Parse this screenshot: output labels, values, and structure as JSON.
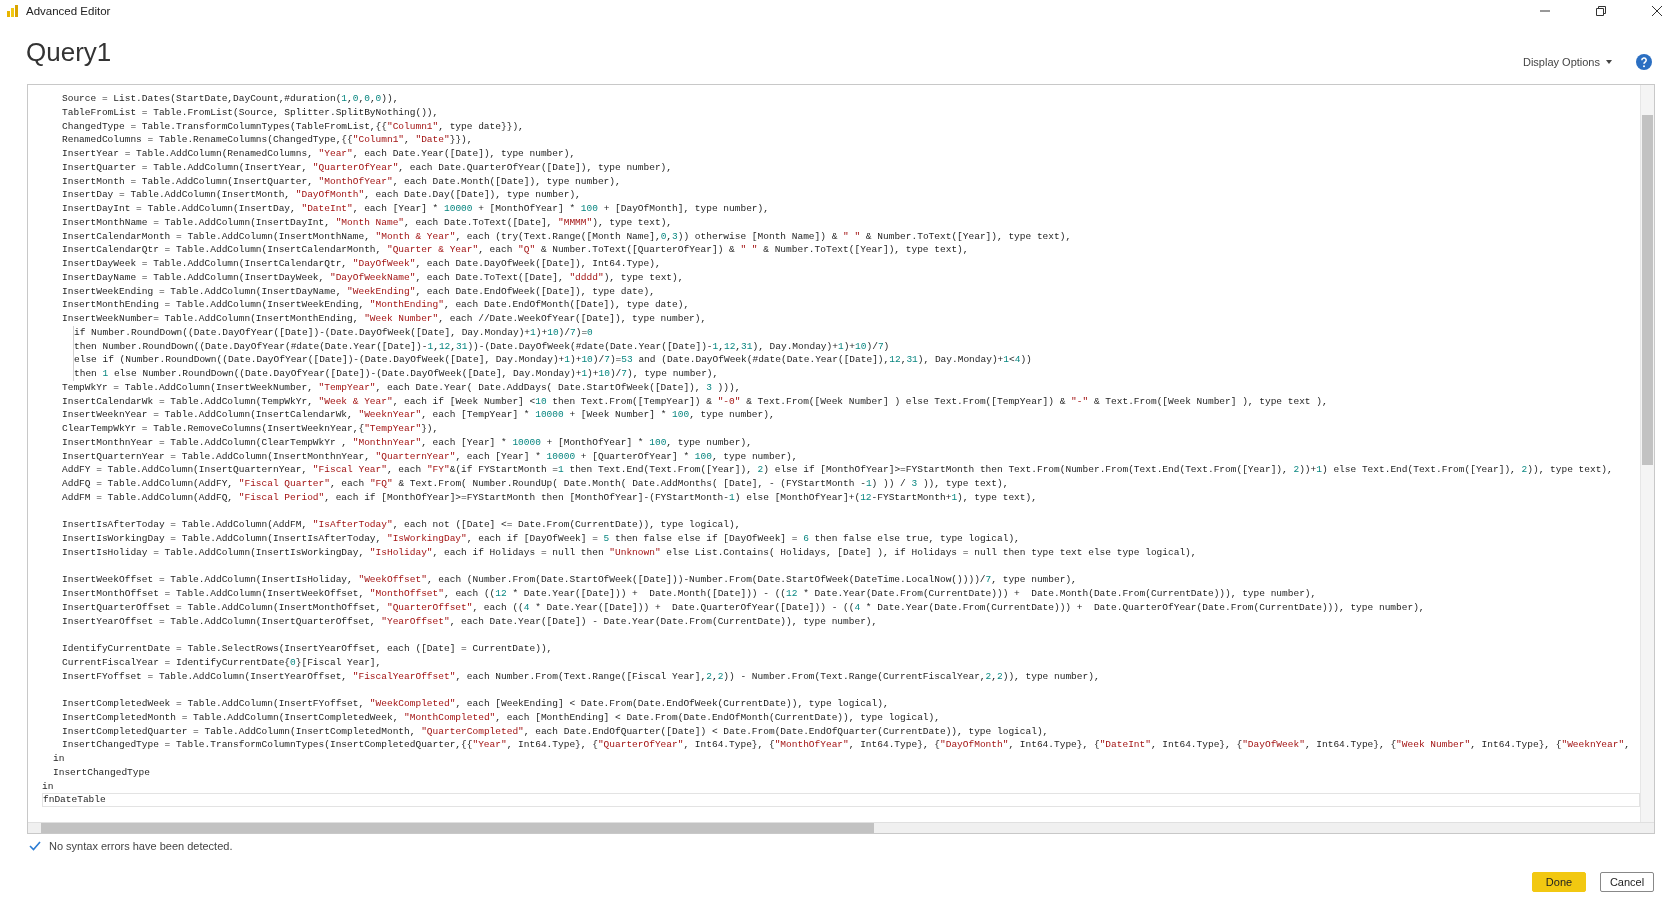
{
  "window": {
    "title": "Advanced Editor"
  },
  "query": {
    "title": "Query1"
  },
  "display_options": {
    "label": "Display Options"
  },
  "editor": {
    "lines": [
      {
        "kind": "statement",
        "current": false,
        "text": "Source = List.Dates(StartDate,DayCount,#duration(1,0,0,0)),"
      },
      {
        "kind": "statement",
        "current": false,
        "text": "TableFromList = Table.FromList(Source, Splitter.SplitByNothing()),"
      },
      {
        "kind": "statement",
        "current": false,
        "text": "ChangedType = Table.TransformColumnTypes(TableFromList,{{\"Column1\", type date}}),"
      },
      {
        "kind": "statement",
        "current": false,
        "text": "RenamedColumns = Table.RenameColumns(ChangedType,{{\"Column1\", \"Date\"}}),"
      },
      {
        "kind": "statement",
        "current": false,
        "text": "InsertYear = Table.AddColumn(RenamedColumns, \"Year\", each Date.Year([Date]), type number),"
      },
      {
        "kind": "statement",
        "current": false,
        "text": "InsertQuarter = Table.AddColumn(InsertYear, \"QuarterOfYear\", each Date.QuarterOfYear([Date]), type number),"
      },
      {
        "kind": "statement",
        "current": false,
        "text": "InsertMonth = Table.AddColumn(InsertQuarter, \"MonthOfYear\", each Date.Month([Date]), type number),"
      },
      {
        "kind": "statement",
        "current": false,
        "text": "InsertDay = Table.AddColumn(InsertMonth, \"DayOfMonth\", each Date.Day([Date]), type number),"
      },
      {
        "kind": "statement",
        "current": false,
        "text": "InsertDayInt = Table.AddColumn(InsertDay, \"DateInt\", each [Year] * 10000 + [MonthOfYear] * 100 + [DayOfMonth], type number),"
      },
      {
        "kind": "statement",
        "current": false,
        "text": "InsertMonthName = Table.AddColumn(InsertDayInt, \"Month Name\", each Date.ToText([Date], \"MMMM\"), type text),"
      },
      {
        "kind": "statement",
        "current": false,
        "text": "InsertCalendarMonth = Table.AddColumn(InsertMonthName, \"Month & Year\", each (try(Text.Range([Month Name],0,3)) otherwise [Month Name]) & \" \" & Number.ToText([Year]), type text),"
      },
      {
        "kind": "statement",
        "current": false,
        "text": "InsertCalendarQtr = Table.AddColumn(InsertCalendarMonth, \"Quarter & Year\", each \"Q\" & Number.ToText([QuarterOfYear]) & \" \" & Number.ToText([Year]), type text),"
      },
      {
        "kind": "statement",
        "current": false,
        "text": "InsertDayWeek = Table.AddColumn(InsertCalendarQtr, \"DayOfWeek\", each Date.DayOfWeek([Date]), Int64.Type),"
      },
      {
        "kind": "statement",
        "current": false,
        "text": "InsertDayName = Table.AddColumn(InsertDayWeek, \"DayOfWeekName\", each Date.ToText([Date], \"dddd\"), type text),"
      },
      {
        "kind": "statement",
        "current": false,
        "text": "InsertWeekEnding = Table.AddColumn(InsertDayName, \"WeekEnding\", each Date.EndOfWeek([Date]), type date),"
      },
      {
        "kind": "statement",
        "current": false,
        "text": "InsertMonthEnding = Table.AddColumn(InsertWeekEnding, \"MonthEnding\", each Date.EndOfMonth([Date]), type date),"
      },
      {
        "kind": "statement",
        "current": false,
        "text": "InsertWeekNumber= Table.AddColumn(InsertMonthEnding, \"Week Number\", each //Date.WeekOfYear([Date]), type number),"
      },
      {
        "kind": "continuation",
        "current": false,
        "text": "if Number.RoundDown((Date.DayOfYear([Date])-(Date.DayOfWeek([Date], Day.Monday)+1)+10)/7)=0"
      },
      {
        "kind": "continuation",
        "current": false,
        "text": "then Number.RoundDown((Date.DayOfYear(#date(Date.Year([Date])-1,12,31))-(Date.DayOfWeek(#date(Date.Year([Date])-1,12,31), Day.Monday)+1)+10)/7)"
      },
      {
        "kind": "continuation",
        "current": false,
        "text": "else if (Number.RoundDown((Date.DayOfYear([Date])-(Date.DayOfWeek([Date], Day.Monday)+1)+10)/7)=53 and (Date.DayOfWeek(#date(Date.Year([Date]),12,31), Day.Monday)+1<4))"
      },
      {
        "kind": "continuation",
        "current": false,
        "text": "then 1 else Number.RoundDown((Date.DayOfYear([Date])-(Date.DayOfWeek([Date], Day.Monday)+1)+10)/7), type number),"
      },
      {
        "kind": "statement",
        "current": false,
        "text": "TempWkYr = Table.AddColumn(InsertWeekNumber, \"TempYear\", each Date.Year( Date.AddDays( Date.StartOfWeek([Date]), 3 ))),"
      },
      {
        "kind": "statement",
        "current": false,
        "text": "InsertCalendarWk = Table.AddColumn(TempWkYr, \"Week & Year\", each if [Week Number] <10 then Text.From([TempYear]) & \"-0\" & Text.From([Week Number] ) else Text.From([TempYear]) & \"-\" & Text.From([Week Number] ), type text ),"
      },
      {
        "kind": "statement",
        "current": false,
        "text": "InsertWeeknYear = Table.AddColumn(InsertCalendarWk, \"WeeknYear\", each [TempYear] * 10000 + [Week Number] * 100, type number),"
      },
      {
        "kind": "statement",
        "current": false,
        "text": "ClearTempWkYr = Table.RemoveColumns(InsertWeeknYear,{\"TempYear\"}),"
      },
      {
        "kind": "statement",
        "current": false,
        "text": "InsertMonthnYear = Table.AddColumn(ClearTempWkYr , \"MonthnYear\", each [Year] * 10000 + [MonthOfYear] * 100, type number),"
      },
      {
        "kind": "statement",
        "current": false,
        "text": "InsertQuarternYear = Table.AddColumn(InsertMonthnYear, \"QuarternYear\", each [Year] * 10000 + [QuarterOfYear] * 100, type number),"
      },
      {
        "kind": "statement",
        "current": false,
        "text": "AddFY = Table.AddColumn(InsertQuarternYear, \"Fiscal Year\", each \"FY\"&(if FYStartMonth =1 then Text.End(Text.From([Year]), 2) else if [MonthOfYear]>=FYStartMonth then Text.From(Number.From(Text.End(Text.From([Year]), 2))+1) else Text.End(Text.From([Year]), 2)), type text),"
      },
      {
        "kind": "statement",
        "current": false,
        "text": "AddFQ = Table.AddColumn(AddFY, \"Fiscal Quarter\", each \"FQ\" & Text.From( Number.RoundUp( Date.Month( Date.AddMonths( [Date], - (FYStartMonth -1) )) / 3 )), type text),"
      },
      {
        "kind": "statement",
        "current": false,
        "text": "AddFM = Table.AddColumn(AddFQ, \"Fiscal Period\", each if [MonthOfYear]>=FYStartMonth then [MonthOfYear]-(FYStartMonth-1) else [MonthOfYear]+(12-FYStartMonth+1), type text),"
      },
      {
        "kind": "blank"
      },
      {
        "kind": "statement",
        "current": false,
        "text": "InsertIsAfterToday = Table.AddColumn(AddFM, \"IsAfterToday\", each not ([Date] <= Date.From(CurrentDate)), type logical),"
      },
      {
        "kind": "statement",
        "current": false,
        "text": "InsertIsWorkingDay = Table.AddColumn(InsertIsAfterToday, \"IsWorkingDay\", each if [DayOfWeek] = 5 then false else if [DayOfWeek] = 6 then false else true, type logical),"
      },
      {
        "kind": "statement",
        "current": false,
        "text": "InsertIsHoliday = Table.AddColumn(InsertIsWorkingDay, \"IsHoliday\", each if Holidays = null then \"Unknown\" else List.Contains( Holidays, [Date] ), if Holidays = null then type text else type logical),"
      },
      {
        "kind": "blank"
      },
      {
        "kind": "statement",
        "current": false,
        "text": "InsertWeekOffset = Table.AddColumn(InsertIsHoliday, \"WeekOffset\", each (Number.From(Date.StartOfWeek([Date]))-Number.From(Date.StartOfWeek(DateTime.LocalNow())))/7, type number),"
      },
      {
        "kind": "statement",
        "current": false,
        "text": "InsertMonthOffset = Table.AddColumn(InsertWeekOffset, \"MonthOffset\", each ((12 * Date.Year([Date])) +  Date.Month([Date])) - ((12 * Date.Year(Date.From(CurrentDate))) +  Date.Month(Date.From(CurrentDate))), type number),"
      },
      {
        "kind": "statement",
        "current": false,
        "text": "InsertQuarterOffset = Table.AddColumn(InsertMonthOffset, \"QuarterOffset\", each ((4 * Date.Year([Date])) +  Date.QuarterOfYear([Date])) - ((4 * Date.Year(Date.From(CurrentDate))) +  Date.QuarterOfYear(Date.From(CurrentDate))), type number),"
      },
      {
        "kind": "statement",
        "current": false,
        "text": "InsertYearOffset = Table.AddColumn(InsertQuarterOffset, \"YearOffset\", each Date.Year([Date]) - Date.Year(Date.From(CurrentDate)), type number),"
      },
      {
        "kind": "blank"
      },
      {
        "kind": "statement",
        "current": false,
        "text": "IdentifyCurrentDate = Table.SelectRows(InsertYearOffset, each ([Date] = CurrentDate)),"
      },
      {
        "kind": "statement",
        "current": false,
        "text": "CurrentFiscalYear = IdentifyCurrentDate{0}[Fiscal Year],"
      },
      {
        "kind": "statement",
        "current": false,
        "text": "InsertFYoffset = Table.AddColumn(InsertYearOffset, \"FiscalYearOffset\", each Number.From(Text.Range([Fiscal Year],2,2)) - Number.From(Text.Range(CurrentFiscalYear,2,2)), type number),"
      },
      {
        "kind": "blank"
      },
      {
        "kind": "statement",
        "current": false,
        "text": "InsertCompletedWeek = Table.AddColumn(InsertFYoffset, \"WeekCompleted\", each [WeekEnding] < Date.From(Date.EndOfWeek(CurrentDate)), type logical),"
      },
      {
        "kind": "statement",
        "current": false,
        "text": "InsertCompletedMonth = Table.AddColumn(InsertCompletedWeek, \"MonthCompleted\", each [MonthEnding] < Date.From(Date.EndOfMonth(CurrentDate)), type logical),"
      },
      {
        "kind": "statement",
        "current": false,
        "text": "InsertCompletedQuarter = Table.AddColumn(InsertCompletedMonth, \"QuarterCompleted\", each Date.EndOfQuarter([Date]) < Date.From(Date.EndOfQuarter(CurrentDate)), type logical),"
      },
      {
        "kind": "statement",
        "current": false,
        "text": "InsertChangedType = Table.TransformColumnTypes(InsertCompletedQuarter,{{\"Year\", Int64.Type}, {\"QuarterOfYear\", Int64.Type}, {\"MonthOfYear\", Int64.Type}, {\"DayOfMonth\", Int64.Type}, {\"DateInt\", Int64.Type}, {\"DayOfWeek\", Int64.Type}, {\"Week Number\", Int64.Type}, {\"WeeknYear\","
      },
      {
        "kind": "middle",
        "current": false,
        "text": "in"
      },
      {
        "kind": "middle",
        "current": false,
        "text": "InsertChangedType"
      },
      {
        "kind": "outer",
        "current": false,
        "text": "in"
      },
      {
        "kind": "outer",
        "current": true,
        "text": "fnDateTable"
      }
    ]
  },
  "status": {
    "text": "No syntax errors have been detected."
  },
  "buttons": [
    {
      "label": "Done",
      "kind": "primary"
    },
    {
      "label": "Cancel",
      "kind": "secondary"
    }
  ]
}
